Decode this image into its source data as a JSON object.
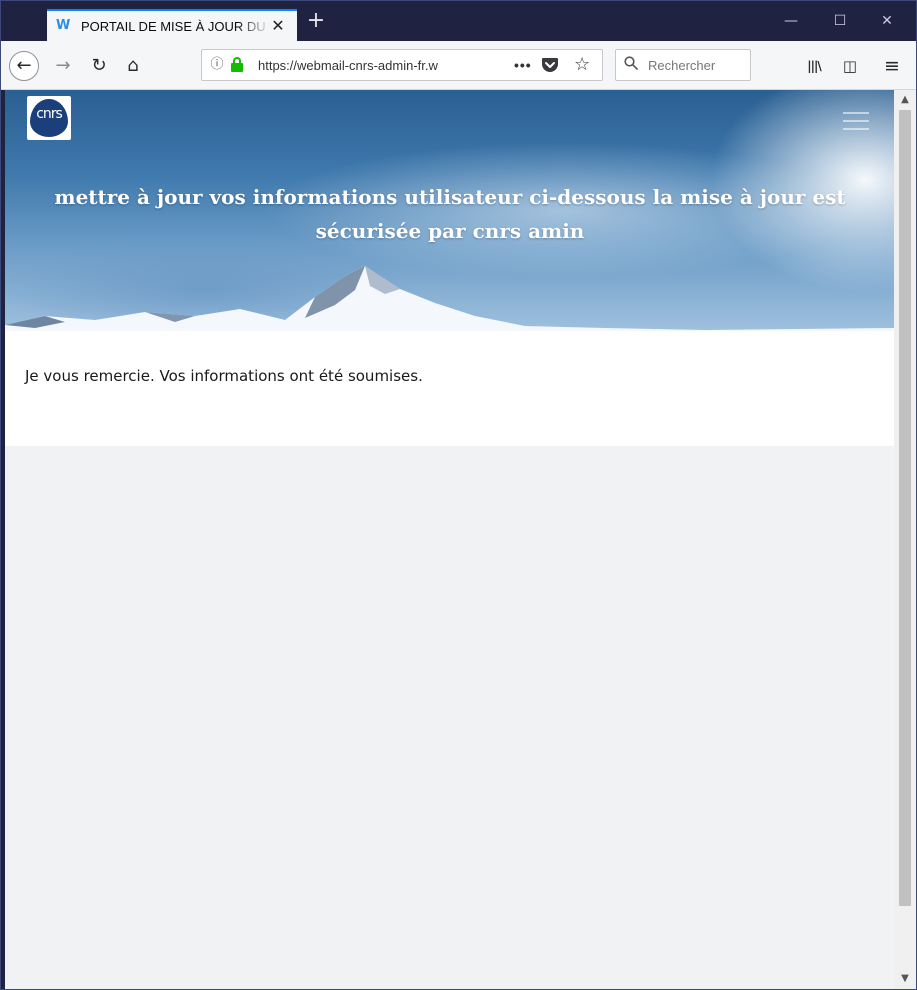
{
  "browser": {
    "tab": {
      "favicon": "W",
      "title": "PORTAIL DE MISE À JOUR DU W",
      "close_glyph": "✕"
    },
    "new_tab_glyph": "+",
    "window_controls": {
      "minimize": "—",
      "maximize": "☐",
      "close": "✕"
    },
    "nav": {
      "back": "←",
      "forward": "→",
      "reload": "↻",
      "home": "⌂"
    },
    "urlbar": {
      "info_glyph": "ⓘ",
      "url": "https://webmail-cnrs-admin-fr.w",
      "more_glyph": "•••",
      "star_glyph": "☆"
    },
    "search": {
      "icon": "🔍",
      "placeholder": "Rechercher"
    },
    "toolbar_icons": {
      "library": "|||\\",
      "sidebar": "◫",
      "menu": "≡"
    },
    "accent_color": "#0a84ff",
    "lock_color": "#12bc00"
  },
  "page": {
    "logo_text": "cnrs",
    "heading": "mettre à jour vos informations utilisateur ci-dessous la mise à jour est sécurisée par cnrs amin",
    "message": "Je vous remercie. Vos informations ont été soumises."
  },
  "scrollbar": {
    "up": "▲",
    "down": "▼"
  }
}
